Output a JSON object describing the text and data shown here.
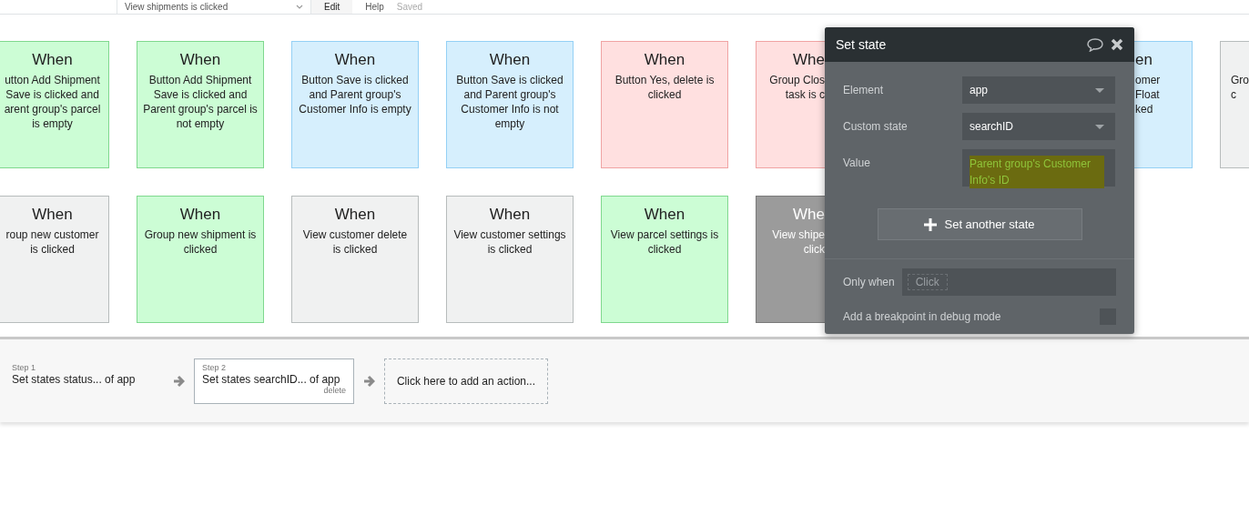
{
  "top_bar": {
    "workflow_dropdown": "View shipments is clicked",
    "menu": [
      {
        "label": "Edit",
        "selected": true
      },
      {
        "label": "Help",
        "selected": false
      }
    ],
    "status": "Saved"
  },
  "event_rows": [
    [
      {
        "kind": "edge-left",
        "color": "#ccfdd5",
        "selected": false,
        "title": "When",
        "lines": [
          "utton Add Shipment",
          "Save is clicked and",
          "arent group's parcel",
          "is empty"
        ]
      },
      {
        "kind": "full",
        "color": "#ccfdd5",
        "selected": false,
        "title": "When",
        "text": "Button Add Shipment Save is clicked and Parent group's parcel is not empty"
      },
      {
        "kind": "full",
        "color": "#d6effd",
        "selected": false,
        "title": "When",
        "text": "Button Save is clicked and Parent group's Customer Info is empty"
      },
      {
        "kind": "full",
        "color": "#d6effd",
        "selected": false,
        "title": "When",
        "text": "Button Save is clicked and Parent group's Customer Info is not empty"
      },
      {
        "kind": "full",
        "color": "#ffe0e0",
        "selected": false,
        "title": "When",
        "text": "Button Yes, delete is clicked"
      },
      {
        "kind": "under-popup",
        "color": "#ffe0e0",
        "selected": false,
        "title": "Whe",
        "lines": [
          "Group Clos",
          "task is c"
        ]
      },
      {
        "kind": "after-popup",
        "color": "#d6effd",
        "selected": false,
        "title": "en",
        "lines": [
          "omer Float",
          "ked"
        ]
      },
      {
        "kind": "edge-right",
        "color": "#f0f1f1",
        "selected": false,
        "lines": [
          "Gro",
          "c"
        ]
      }
    ],
    [
      {
        "kind": "edge-left",
        "color": "#f0f1f1",
        "selected": false,
        "title": "When",
        "lines": [
          "roup new customer",
          "is clicked"
        ]
      },
      {
        "kind": "full",
        "color": "#ccfdd5",
        "selected": false,
        "title": "When",
        "text": "Group new shipment is clicked"
      },
      {
        "kind": "full",
        "color": "#f0f1f1",
        "selected": false,
        "title": "When",
        "text": "View customer delete is clicked"
      },
      {
        "kind": "full",
        "color": "#f0f1f1",
        "selected": false,
        "title": "When",
        "text": "View customer settings is clicked"
      },
      {
        "kind": "full",
        "color": "#ccfdd5",
        "selected": false,
        "title": "When",
        "text": "View parcel settings is clicked"
      },
      {
        "kind": "under-popup",
        "color": "#9b9b9b",
        "selected": true,
        "title": "Whe",
        "lines": [
          "View shipe",
          "click"
        ]
      }
    ]
  ],
  "popup": {
    "title": "Set state",
    "fields": [
      {
        "kind": "dropdown",
        "label": "Element",
        "value": "app"
      },
      {
        "kind": "dropdown",
        "label": "Custom state",
        "value": "searchID"
      },
      {
        "kind": "expression",
        "label": "Value",
        "value": "Parent group's Customer Info's ID",
        "highlighted": true
      }
    ],
    "add_button": "Set another state",
    "only_when": {
      "label": "Only when",
      "placeholder": "Click"
    },
    "breakpoint": {
      "label": "Add a breakpoint in debug mode",
      "checked": false
    }
  },
  "workflow": {
    "steps": [
      {
        "step": "Step 1",
        "action": "Set states status... of app",
        "selected": false
      },
      {
        "step": "Step 2",
        "action": "Set states searchID... of app",
        "selected": true,
        "delete": "delete"
      }
    ],
    "add_action": "Click here to add an action..."
  }
}
